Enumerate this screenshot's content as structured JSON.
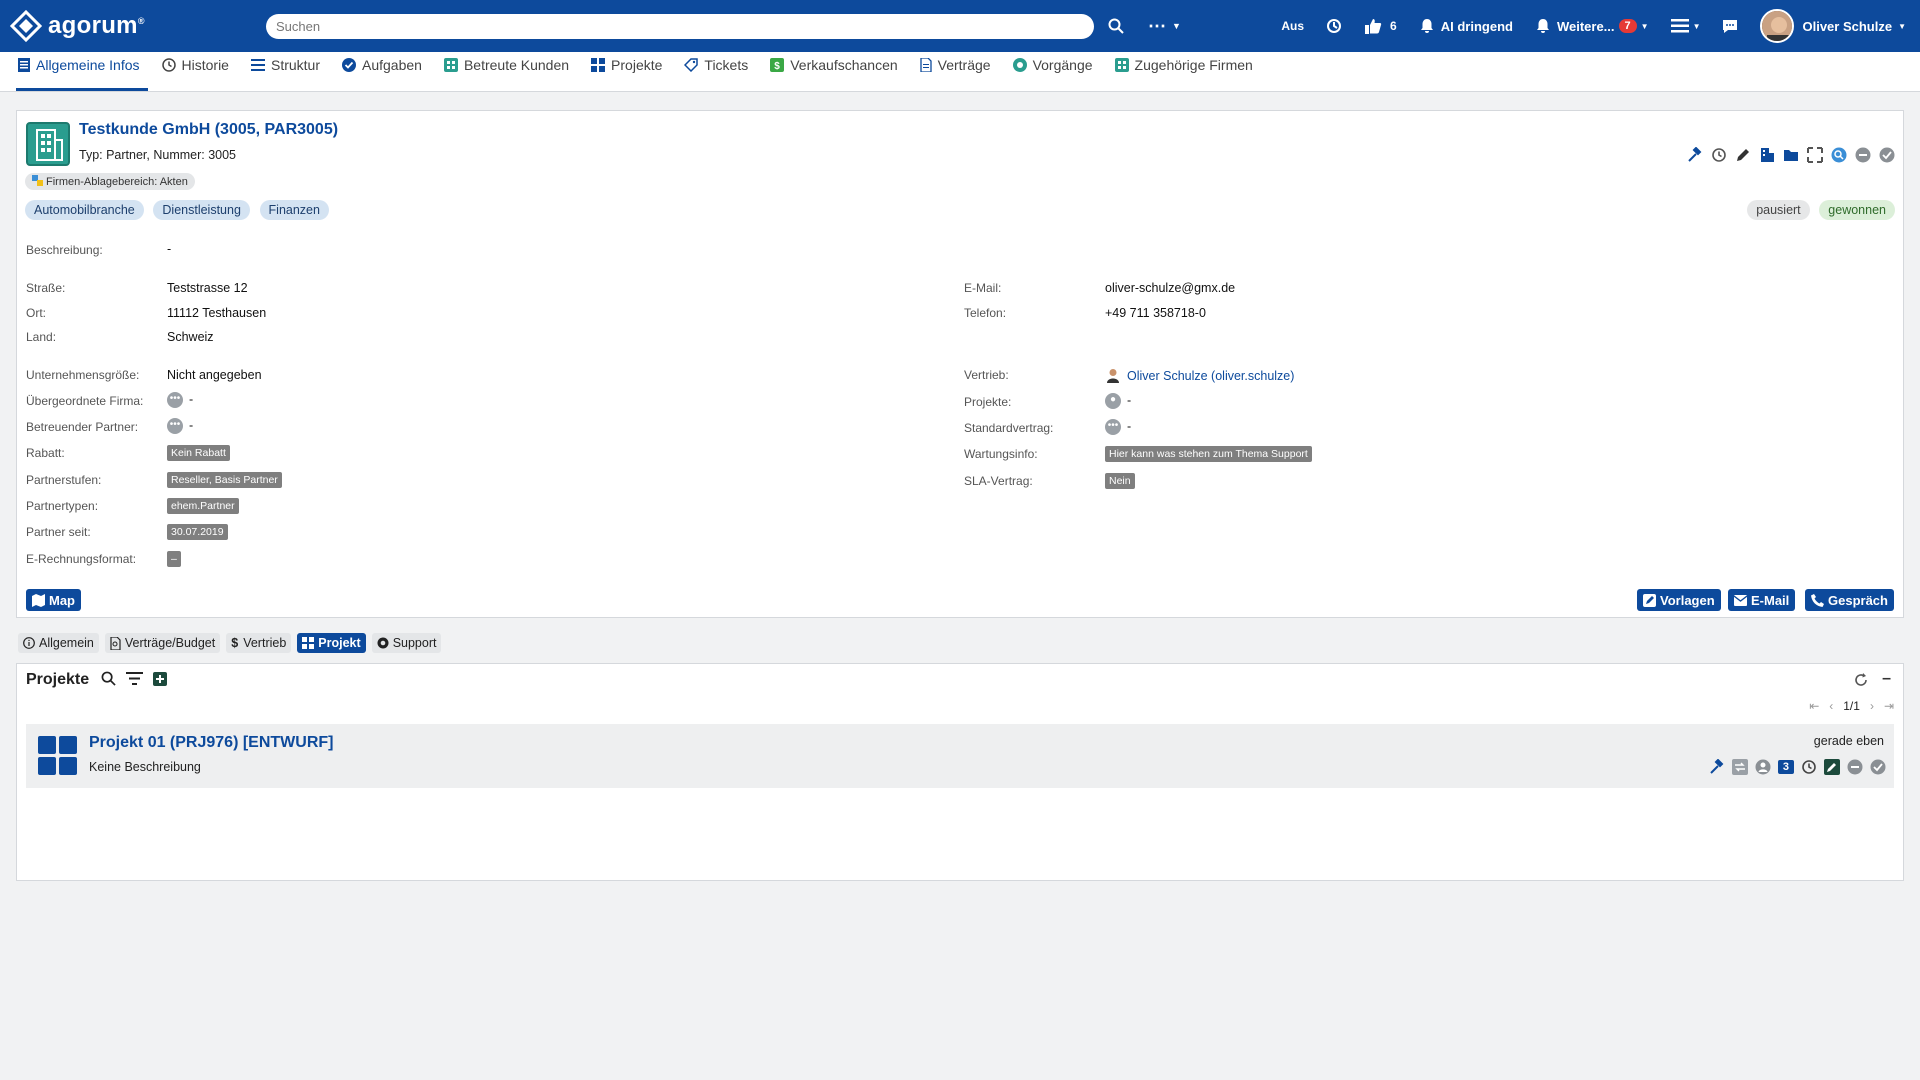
{
  "topbar": {
    "logo_text": "agorum",
    "logo_reg": "®",
    "search_placeholder": "Suchen",
    "status": "Aus",
    "likes": "6",
    "ai_label": "AI dringend",
    "more_label": "Weitere...",
    "more_count": "7",
    "user_name": "Oliver Schulze"
  },
  "tabs": [
    {
      "label": "Allgemeine Infos",
      "icon": "document-icon"
    },
    {
      "label": "Historie",
      "icon": "clock-icon"
    },
    {
      "label": "Struktur",
      "icon": "list-icon"
    },
    {
      "label": "Aufgaben",
      "icon": "check-circle-icon"
    },
    {
      "label": "Betreute Kunden",
      "icon": "building-icon"
    },
    {
      "label": "Projekte",
      "icon": "grid-icon"
    },
    {
      "label": "Tickets",
      "icon": "tag-icon"
    },
    {
      "label": "Verkaufschancen",
      "icon": "dollar-icon"
    },
    {
      "label": "Verträge",
      "icon": "contract-icon"
    },
    {
      "label": "Vorgänge",
      "icon": "support-icon"
    },
    {
      "label": "Zugehörige Firmen",
      "icon": "building-icon"
    }
  ],
  "company": {
    "title": "Testkunde GmbH (3005, PAR3005)",
    "subtitle": "Typ: Partner, Nummer: 3005",
    "folder_tag": "Firmen-Ablagebereich: Akten",
    "tags": [
      "Automobilbranche",
      "Dienstleistung",
      "Finanzen"
    ],
    "status_tags": [
      "pausiert",
      "gewonnen"
    ]
  },
  "fields_left": {
    "beschreibung_label": "Beschreibung:",
    "beschreibung": "-",
    "strasse_label": "Straße:",
    "strasse": "Teststrasse 12",
    "ort_label": "Ort:",
    "ort": "11112 Testhausen",
    "land_label": "Land:",
    "land": "Schweiz",
    "groesse_label": "Unternehmensgröße:",
    "groesse": "Nicht angegeben",
    "uebergeordnet_label": "Übergeordnete Firma:",
    "uebergeordnet": "-",
    "partner_label": "Betreuender Partner:",
    "partner": "-",
    "rabatt_label": "Rabatt:",
    "rabatt": "Kein Rabatt",
    "stufen_label": "Partnerstufen:",
    "stufen": "Reseller, Basis Partner",
    "typen_label": "Partnertypen:",
    "typen": "ehem.Partner",
    "seit_label": "Partner seit:",
    "seit": "30.07.2019",
    "erechnung_label": "E-Rechnungsformat:",
    "erechnung": "–"
  },
  "fields_right": {
    "email_label": "E-Mail:",
    "email": "oliver-schulze@gmx.de",
    "telefon_label": "Telefon:",
    "telefon": "+49 711 358718-0",
    "vertrieb_label": "Vertrieb:",
    "vertrieb": "Oliver Schulze (oliver.schulze)",
    "projekte_label": "Projekte:",
    "projekte": "-",
    "standard_label": "Standardvertrag:",
    "standard": "-",
    "wartung_label": "Wartungsinfo:",
    "wartung": "Hier kann was stehen zum Thema Support",
    "sla_label": "SLA-Vertrag:",
    "sla": "Nein"
  },
  "buttons": {
    "map": "Map",
    "vorlagen": "Vorlagen",
    "email": "E-Mail",
    "gespraech": "Gespräch"
  },
  "subtabs": [
    "Allgemein",
    "Verträge/Budget",
    "Vertrieb",
    "Projekt",
    "Support"
  ],
  "projects": {
    "heading": "Projekte",
    "pager": "1/1",
    "item_title": "Projekt 01 (PRJ976) [ENTWURF]",
    "item_desc": "Keine Beschreibung",
    "item_time": "gerade eben",
    "item_count": "3"
  },
  "colors": {
    "brand": "#0d4a9c",
    "accent": "#2a9d8f"
  }
}
